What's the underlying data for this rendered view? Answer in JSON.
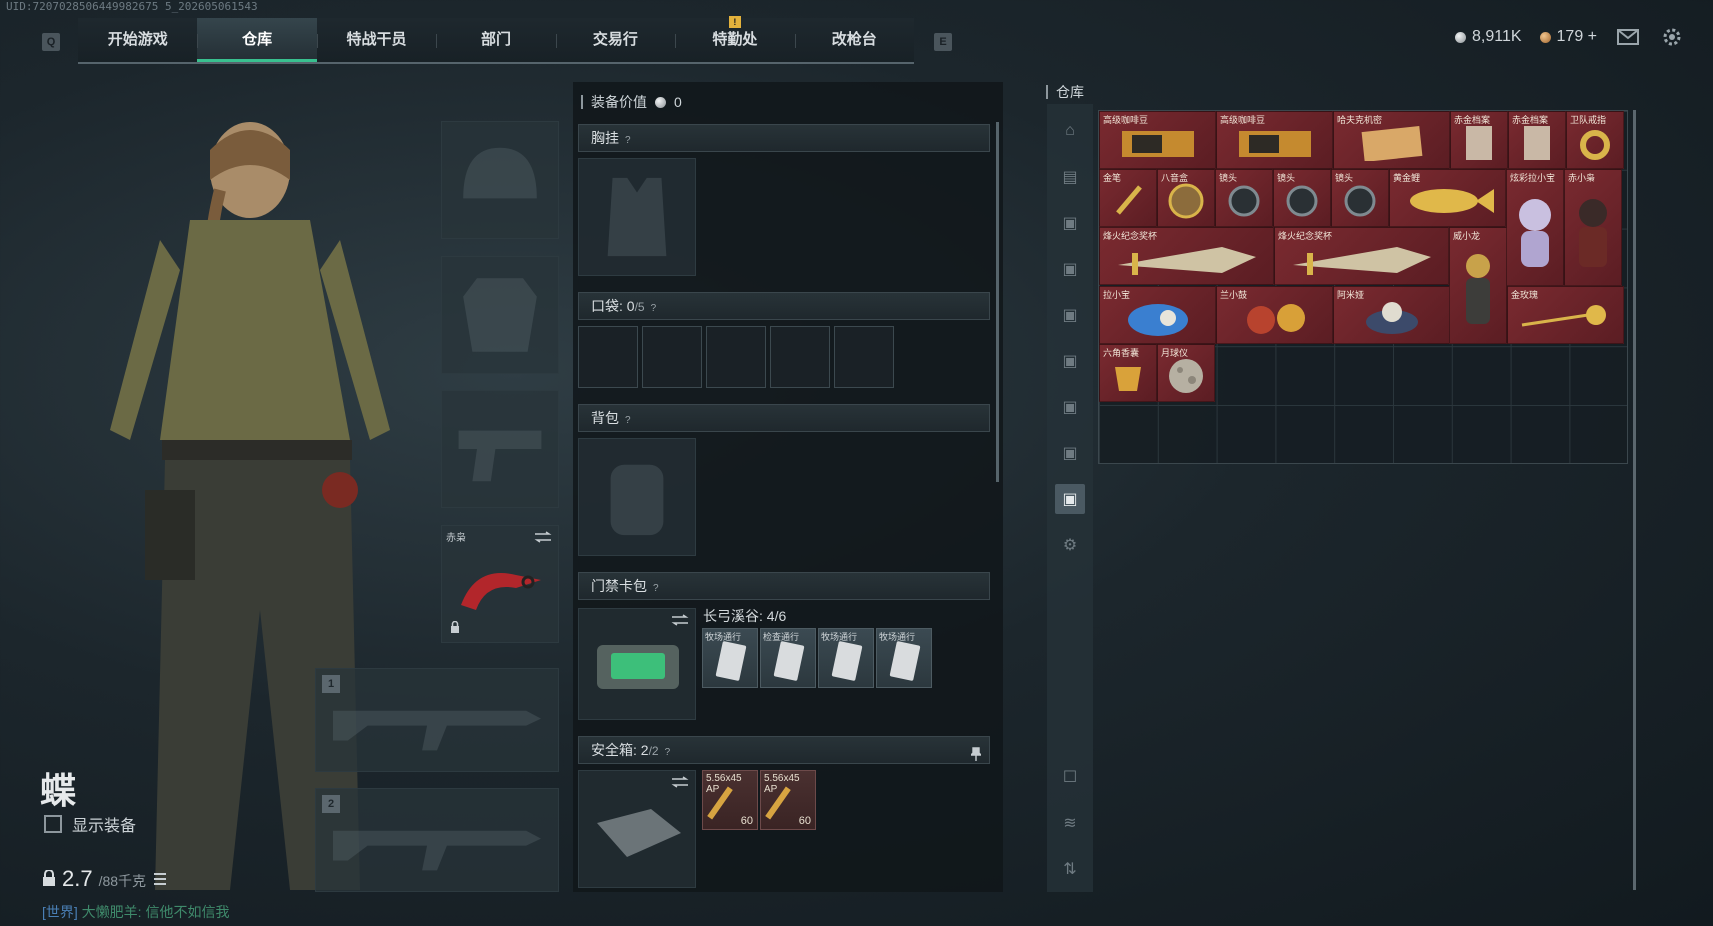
{
  "uid": "UID:7207028506449982675 5_202605061543",
  "nav": {
    "left_key": "Q",
    "right_key": "E",
    "tabs": [
      "开始游戏",
      "仓库",
      "特战干员",
      "部门",
      "交易行",
      "特勤处",
      "改枪台"
    ],
    "active_tab": "仓库",
    "warn_mark": "!"
  },
  "topbar": {
    "silver": "8,911K",
    "bronze": "179 +"
  },
  "character": {
    "name": "蝶",
    "show_equipment_label": "显示装备",
    "weight_value": "2.7",
    "weight_cap": "/88千克",
    "chat_channel": "[世界]",
    "chat_text": "大懒肥羊: 信他不如信我"
  },
  "equip": {
    "melee_label": "赤枭",
    "weapon1_num": "1",
    "weapon2_num": "2"
  },
  "loadout": {
    "value_label": "装备价值",
    "value": "0",
    "chest_rig": "胸挂",
    "pockets": "口袋:",
    "pockets_used": "0",
    "pockets_total": "/5",
    "backpack": "背包",
    "keycard": "门禁卡包",
    "keycard_zone": "长弓溪谷: 4/6",
    "keycard_items": [
      "牧场通行",
      "检查通行",
      "牧场通行",
      "牧场通行"
    ],
    "safe_box": "安全箱:",
    "safe_used": "2",
    "safe_total": "/2",
    "ammo": [
      {
        "label": "5.56x45 AP",
        "count": "60"
      },
      {
        "label": "5.56x45 AP",
        "count": "60"
      }
    ],
    "help": "?"
  },
  "storage": {
    "title": "仓库",
    "items": [
      {
        "label": "高级咖啡豆",
        "style": "red"
      },
      {
        "label": "高级咖啡豆",
        "style": "red"
      },
      {
        "label": "哈夫克机密",
        "style": "red"
      },
      {
        "label": "赤金档案",
        "style": "red"
      },
      {
        "label": "赤金档案",
        "style": "red"
      },
      {
        "label": "卫队戒指",
        "style": "red"
      },
      {
        "label": "金笔",
        "style": "red"
      },
      {
        "label": "八音盒",
        "style": "red"
      },
      {
        "label": "镜头",
        "style": "red"
      },
      {
        "label": "镜头",
        "style": "red"
      },
      {
        "label": "镜头",
        "style": "red"
      },
      {
        "label": "黄金鲤",
        "style": "red"
      },
      {
        "label": "炫彩拉小宝",
        "style": "red"
      },
      {
        "label": "赤小枭",
        "style": "red"
      },
      {
        "label": "烽火纪念奖杯",
        "style": "red"
      },
      {
        "label": "烽火纪念奖杯",
        "style": "red"
      },
      {
        "label": "威小龙",
        "style": "red"
      },
      {
        "label": "拉小宝",
        "style": "red"
      },
      {
        "label": "兰小鼓",
        "style": "red"
      },
      {
        "label": "阿米娅",
        "style": "red"
      },
      {
        "label": "金玫瑰",
        "style": "red"
      },
      {
        "label": "六角香囊",
        "style": "red"
      },
      {
        "label": "月球仪",
        "style": "red"
      }
    ]
  },
  "icons": [
    "silver-coin-icon",
    "bronze-coin-icon",
    "mail-icon",
    "settings-icon",
    "lock-icon",
    "swap-icon",
    "list-icon",
    "pin-icon"
  ]
}
